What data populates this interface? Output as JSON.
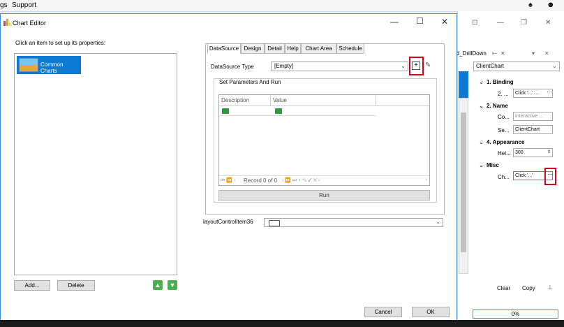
{
  "menubar": {
    "items": [
      "gs",
      "Support"
    ]
  },
  "dialog": {
    "title": "Chart Editor",
    "left_hint": "Click an item to set up  its properties:",
    "items": [
      {
        "label": "Common Charts"
      }
    ],
    "add_label": "Add...",
    "delete_label": "Delete",
    "tabs": [
      "DataSource",
      "Design",
      "Detail",
      "Help",
      "Chart Area",
      "Schedule"
    ],
    "datasource_type_label": "DataSource Type",
    "datasource_type_value": "[Empty]",
    "group_title": "Set Parameters And Run",
    "grid_columns": [
      "Description",
      "Value"
    ],
    "grid_nav_record": "Record 0 of 0",
    "run_label": "Run",
    "layout_item_label": "layoutControlItem36",
    "cancel_label": "Cancel",
    "ok_label": "OK"
  },
  "right_panel": {
    "tab_label": "rd_DrillDown",
    "combo_value": "ClientChart",
    "categories": [
      {
        "label": "1. Binding",
        "props": [
          {
            "name": "2. ...",
            "value": "Click '...' ..."
          }
        ]
      },
      {
        "label": "2. Name",
        "props": [
          {
            "name": "Co...",
            "value": "Interactive ..."
          },
          {
            "name": "Se...",
            "value": "ClientChart"
          }
        ]
      },
      {
        "label": "4. Appearance",
        "props": [
          {
            "name": "Hei...",
            "value": "300"
          }
        ]
      },
      {
        "label": "Misc",
        "props": [
          {
            "name": "Ch...",
            "value": "Click '...'"
          }
        ]
      }
    ],
    "clear_label": "Clear",
    "copy_label": "Copy",
    "progress_text": "0%"
  },
  "colors": {
    "accent": "#0e7ad4",
    "highlight_border": "#d0021b",
    "window_border": "#3b8de0"
  }
}
